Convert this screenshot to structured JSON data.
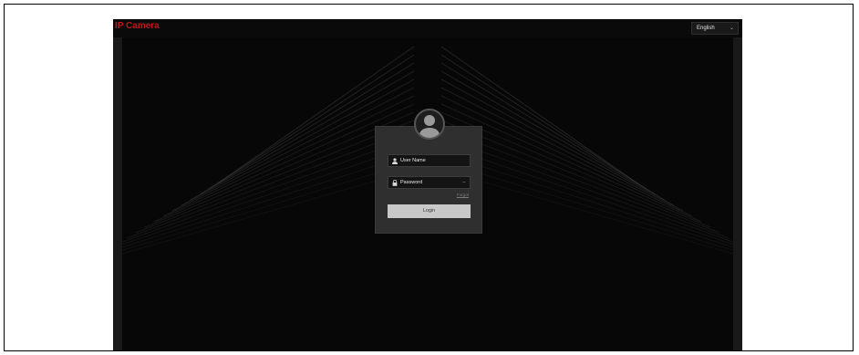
{
  "header": {
    "brand": "IP Camera",
    "language": "English"
  },
  "login": {
    "username_placeholder": "User Name",
    "password_placeholder": "Password",
    "forgot_label": "Forgot",
    "login_label": "Login"
  },
  "colors": {
    "brand": "#c01818",
    "background": "#070707",
    "panel": "#2f2f2f",
    "button": "#c8c8c8"
  },
  "icons": {
    "user": "user-icon",
    "lock": "lock-icon",
    "eye": "eye-icon",
    "avatar": "avatar-icon",
    "chevron": "chevron-down-icon"
  }
}
